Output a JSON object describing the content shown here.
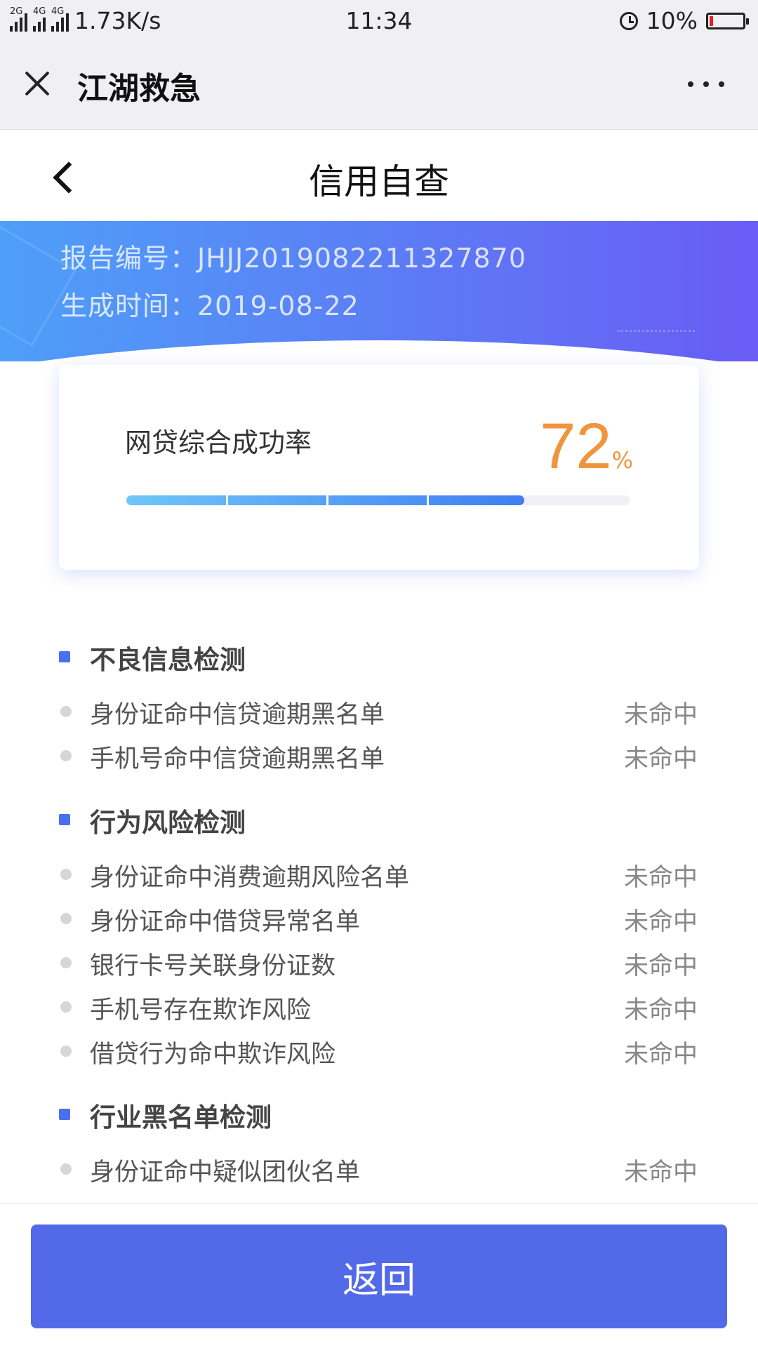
{
  "status_bar": {
    "network_speed": "1.73K/s",
    "time": "11:34",
    "battery": "10%",
    "battery_level": 0.1,
    "signal_labels": [
      "2G",
      "4G",
      "4G"
    ]
  },
  "app_bar": {
    "title": "江湖救急"
  },
  "page": {
    "title": "信用自查"
  },
  "report": {
    "id_line": "报告编号：JHJJ2019082211327870",
    "date_line": "生成时间：2019-08-22"
  },
  "rate_card": {
    "label": "网贷综合成功率",
    "value": "72",
    "unit": "%",
    "progress": 0.79
  },
  "sections": [
    {
      "title": "不良信息检测",
      "items": [
        {
          "label": "身份证命中信贷逾期黑名单",
          "status": "未命中"
        },
        {
          "label": "手机号命中信贷逾期黑名单",
          "status": "未命中"
        }
      ]
    },
    {
      "title": "行为风险检测",
      "items": [
        {
          "label": "身份证命中消费逾期风险名单",
          "status": "未命中"
        },
        {
          "label": "身份证命中借贷异常名单",
          "status": "未命中"
        },
        {
          "label": "银行卡号关联身份证数",
          "status": "未命中"
        },
        {
          "label": "手机号存在欺诈风险",
          "status": "未命中"
        },
        {
          "label": "借贷行为命中欺诈风险",
          "status": "未命中"
        }
      ]
    },
    {
      "title": "行业黑名单检测",
      "items": [
        {
          "label": "身份证命中疑似团伙名单",
          "status": "未命中"
        }
      ]
    }
  ],
  "footer": {
    "return_label": "返回"
  },
  "colors": {
    "accent": "#536ae8",
    "rate": "#f0953e",
    "banner_start": "#4e9ff8",
    "banner_end": "#6a5cf5"
  }
}
